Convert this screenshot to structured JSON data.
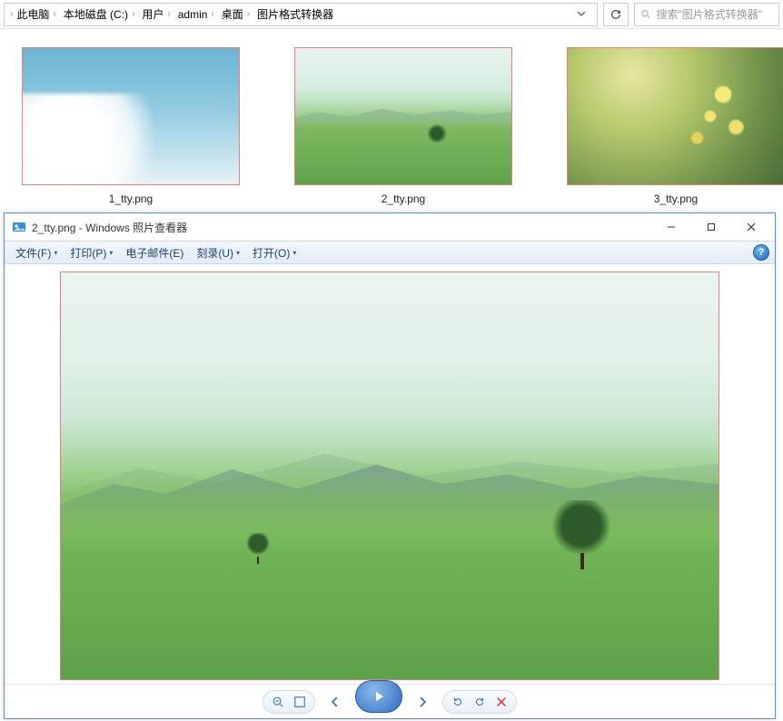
{
  "explorer": {
    "breadcrumbs": [
      "此电脑",
      "本地磁盘 (C:)",
      "用户",
      "admin",
      "桌面",
      "图片格式转换器"
    ],
    "search_placeholder": "搜索\"图片格式转换器\""
  },
  "thumbnails": [
    {
      "label": "1_tty.png",
      "scene": "clouds"
    },
    {
      "label": "2_tty.png",
      "scene": "hills"
    },
    {
      "label": "3_tty.png",
      "scene": "flowers"
    }
  ],
  "viewer": {
    "title": "2_tty.png - Windows 照片查看器",
    "menu": {
      "file": "文件(F)",
      "print": "打印(P)",
      "email": "电子邮件(E)",
      "burn": "刻录(U)",
      "open": "打开(O)"
    },
    "help_symbol": "?"
  }
}
